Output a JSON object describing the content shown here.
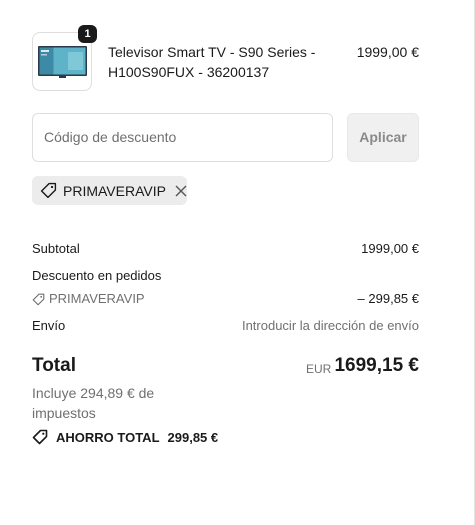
{
  "product": {
    "quantity": "1",
    "name": "Televisor Smart TV - S90 Series - H100S90FUX - 36200137",
    "price": "1999,00 €"
  },
  "discount": {
    "placeholder": "Código de descuento",
    "value": "",
    "apply_label": "Aplicar",
    "applied_code": "PRIMAVERAVIP"
  },
  "summary": {
    "subtotal_label": "Subtotal",
    "subtotal_value": "1999,00 €",
    "order_discount_label": "Descuento en pedidos",
    "order_discount_code": "PRIMAVERAVIP",
    "order_discount_value": "– 299,85 €",
    "shipping_label": "Envío",
    "shipping_value": "Introducir la dirección de envío",
    "total_label": "Total",
    "currency": "EUR",
    "total_value": "1699,15 €",
    "tax_note": "Incluye 294,89 € de impuestos",
    "savings_label": "AHORRO TOTAL",
    "savings_value": "299,85 €"
  }
}
